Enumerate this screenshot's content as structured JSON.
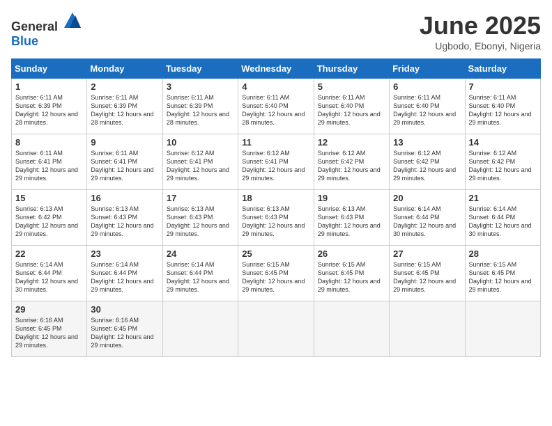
{
  "header": {
    "logo_general": "General",
    "logo_blue": "Blue",
    "month": "June 2025",
    "location": "Ugbodo, Ebonyi, Nigeria"
  },
  "weekdays": [
    "Sunday",
    "Monday",
    "Tuesday",
    "Wednesday",
    "Thursday",
    "Friday",
    "Saturday"
  ],
  "weeks": [
    [
      {
        "day": "1",
        "sunrise": "6:11 AM",
        "sunset": "6:39 PM",
        "daylight": "12 hours and 28 minutes."
      },
      {
        "day": "2",
        "sunrise": "6:11 AM",
        "sunset": "6:39 PM",
        "daylight": "12 hours and 28 minutes."
      },
      {
        "day": "3",
        "sunrise": "6:11 AM",
        "sunset": "6:39 PM",
        "daylight": "12 hours and 28 minutes."
      },
      {
        "day": "4",
        "sunrise": "6:11 AM",
        "sunset": "6:40 PM",
        "daylight": "12 hours and 28 minutes."
      },
      {
        "day": "5",
        "sunrise": "6:11 AM",
        "sunset": "6:40 PM",
        "daylight": "12 hours and 29 minutes."
      },
      {
        "day": "6",
        "sunrise": "6:11 AM",
        "sunset": "6:40 PM",
        "daylight": "12 hours and 29 minutes."
      },
      {
        "day": "7",
        "sunrise": "6:11 AM",
        "sunset": "6:40 PM",
        "daylight": "12 hours and 29 minutes."
      }
    ],
    [
      {
        "day": "8",
        "sunrise": "6:11 AM",
        "sunset": "6:41 PM",
        "daylight": "12 hours and 29 minutes."
      },
      {
        "day": "9",
        "sunrise": "6:11 AM",
        "sunset": "6:41 PM",
        "daylight": "12 hours and 29 minutes."
      },
      {
        "day": "10",
        "sunrise": "6:12 AM",
        "sunset": "6:41 PM",
        "daylight": "12 hours and 29 minutes."
      },
      {
        "day": "11",
        "sunrise": "6:12 AM",
        "sunset": "6:41 PM",
        "daylight": "12 hours and 29 minutes."
      },
      {
        "day": "12",
        "sunrise": "6:12 AM",
        "sunset": "6:42 PM",
        "daylight": "12 hours and 29 minutes."
      },
      {
        "day": "13",
        "sunrise": "6:12 AM",
        "sunset": "6:42 PM",
        "daylight": "12 hours and 29 minutes."
      },
      {
        "day": "14",
        "sunrise": "6:12 AM",
        "sunset": "6:42 PM",
        "daylight": "12 hours and 29 minutes."
      }
    ],
    [
      {
        "day": "15",
        "sunrise": "6:13 AM",
        "sunset": "6:42 PM",
        "daylight": "12 hours and 29 minutes."
      },
      {
        "day": "16",
        "sunrise": "6:13 AM",
        "sunset": "6:43 PM",
        "daylight": "12 hours and 29 minutes."
      },
      {
        "day": "17",
        "sunrise": "6:13 AM",
        "sunset": "6:43 PM",
        "daylight": "12 hours and 29 minutes."
      },
      {
        "day": "18",
        "sunrise": "6:13 AM",
        "sunset": "6:43 PM",
        "daylight": "12 hours and 29 minutes."
      },
      {
        "day": "19",
        "sunrise": "6:13 AM",
        "sunset": "6:43 PM",
        "daylight": "12 hours and 29 minutes."
      },
      {
        "day": "20",
        "sunrise": "6:14 AM",
        "sunset": "6:44 PM",
        "daylight": "12 hours and 30 minutes."
      },
      {
        "day": "21",
        "sunrise": "6:14 AM",
        "sunset": "6:44 PM",
        "daylight": "12 hours and 30 minutes."
      }
    ],
    [
      {
        "day": "22",
        "sunrise": "6:14 AM",
        "sunset": "6:44 PM",
        "daylight": "12 hours and 30 minutes."
      },
      {
        "day": "23",
        "sunrise": "6:14 AM",
        "sunset": "6:44 PM",
        "daylight": "12 hours and 29 minutes."
      },
      {
        "day": "24",
        "sunrise": "6:14 AM",
        "sunset": "6:44 PM",
        "daylight": "12 hours and 29 minutes."
      },
      {
        "day": "25",
        "sunrise": "6:15 AM",
        "sunset": "6:45 PM",
        "daylight": "12 hours and 29 minutes."
      },
      {
        "day": "26",
        "sunrise": "6:15 AM",
        "sunset": "6:45 PM",
        "daylight": "12 hours and 29 minutes."
      },
      {
        "day": "27",
        "sunrise": "6:15 AM",
        "sunset": "6:45 PM",
        "daylight": "12 hours and 29 minutes."
      },
      {
        "day": "28",
        "sunrise": "6:15 AM",
        "sunset": "6:45 PM",
        "daylight": "12 hours and 29 minutes."
      }
    ],
    [
      {
        "day": "29",
        "sunrise": "6:16 AM",
        "sunset": "6:45 PM",
        "daylight": "12 hours and 29 minutes."
      },
      {
        "day": "30",
        "sunrise": "6:16 AM",
        "sunset": "6:45 PM",
        "daylight": "12 hours and 29 minutes."
      },
      null,
      null,
      null,
      null,
      null
    ]
  ]
}
